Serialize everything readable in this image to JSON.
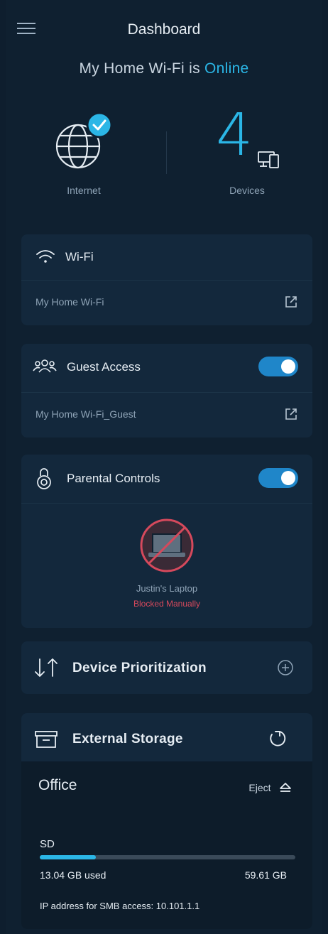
{
  "header": {
    "title": "Dashboard",
    "status_prefix": "My Home Wi-Fi is ",
    "status_value": "Online"
  },
  "summary": {
    "internet_label": "Internet",
    "device_count": "4",
    "devices_label": "Devices"
  },
  "wifi": {
    "title": "Wi-Fi",
    "network_name": "My Home Wi-Fi"
  },
  "guest": {
    "title": "Guest Access",
    "network_name": "My Home Wi-Fi_Guest",
    "enabled": true
  },
  "parental": {
    "title": "Parental Controls",
    "enabled": true,
    "device_name": "Justin's Laptop",
    "device_status": "Blocked Manually"
  },
  "prioritization": {
    "title": "Device Prioritization"
  },
  "storage": {
    "title": "External Storage",
    "drive_name": "Office",
    "eject_label": "Eject",
    "volume_label": "SD",
    "used_label": "13.04 GB used",
    "total_label": "59.61 GB",
    "used_fraction": 0.219,
    "smb_label": "IP address for SMB access: 10.101.1.1"
  },
  "colors": {
    "accent": "#2bb6e6",
    "toggle_on": "#1f86c9",
    "blocked": "#d5495c",
    "background": "#0f2030",
    "card": "#13283c"
  }
}
